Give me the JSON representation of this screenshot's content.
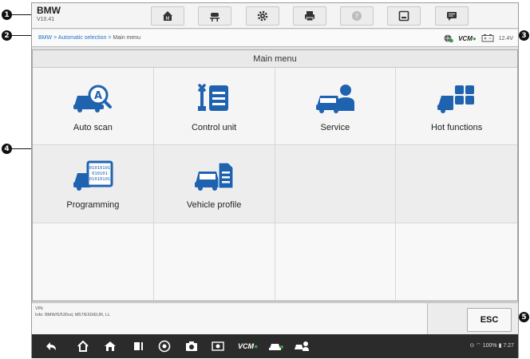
{
  "header": {
    "title": "BMW",
    "version": "V10.41"
  },
  "toolbar": {
    "icons": [
      "home-icon",
      "vehicle-lift-icon",
      "gear-icon",
      "printer-icon",
      "help-icon",
      "save-icon",
      "chat-icon"
    ]
  },
  "breadcrumb": {
    "links": [
      "BMW",
      "Automatic selection"
    ],
    "separator": ">",
    "current": "Main menu"
  },
  "status": {
    "vcm_label": "VCM",
    "voltage": "12.4V"
  },
  "main": {
    "title": "Main menu",
    "items": [
      {
        "label": "Auto scan",
        "icon": "auto-scan-icon"
      },
      {
        "label": "Control unit",
        "icon": "control-unit-icon"
      },
      {
        "label": "Service",
        "icon": "service-icon"
      },
      {
        "label": "Hot functions",
        "icon": "hot-functions-icon"
      },
      {
        "label": "Programming",
        "icon": "programming-icon"
      },
      {
        "label": "Vehicle profile",
        "icon": "vehicle-profile-icon"
      }
    ]
  },
  "footer": {
    "vin_line": "VIN:",
    "info_line": "Info: BMW/5/530xd, M57/E60/EUR, LL",
    "esc_label": "ESC"
  },
  "system_bar": {
    "vcm_label": "VCM",
    "status": "100%",
    "time": "7:27"
  },
  "callouts": [
    "1",
    "2",
    "3",
    "4",
    "5"
  ],
  "colors": {
    "accent": "#2a72c9",
    "icon_blue": "#1f63b0",
    "vcm_green": "#38a23a"
  }
}
